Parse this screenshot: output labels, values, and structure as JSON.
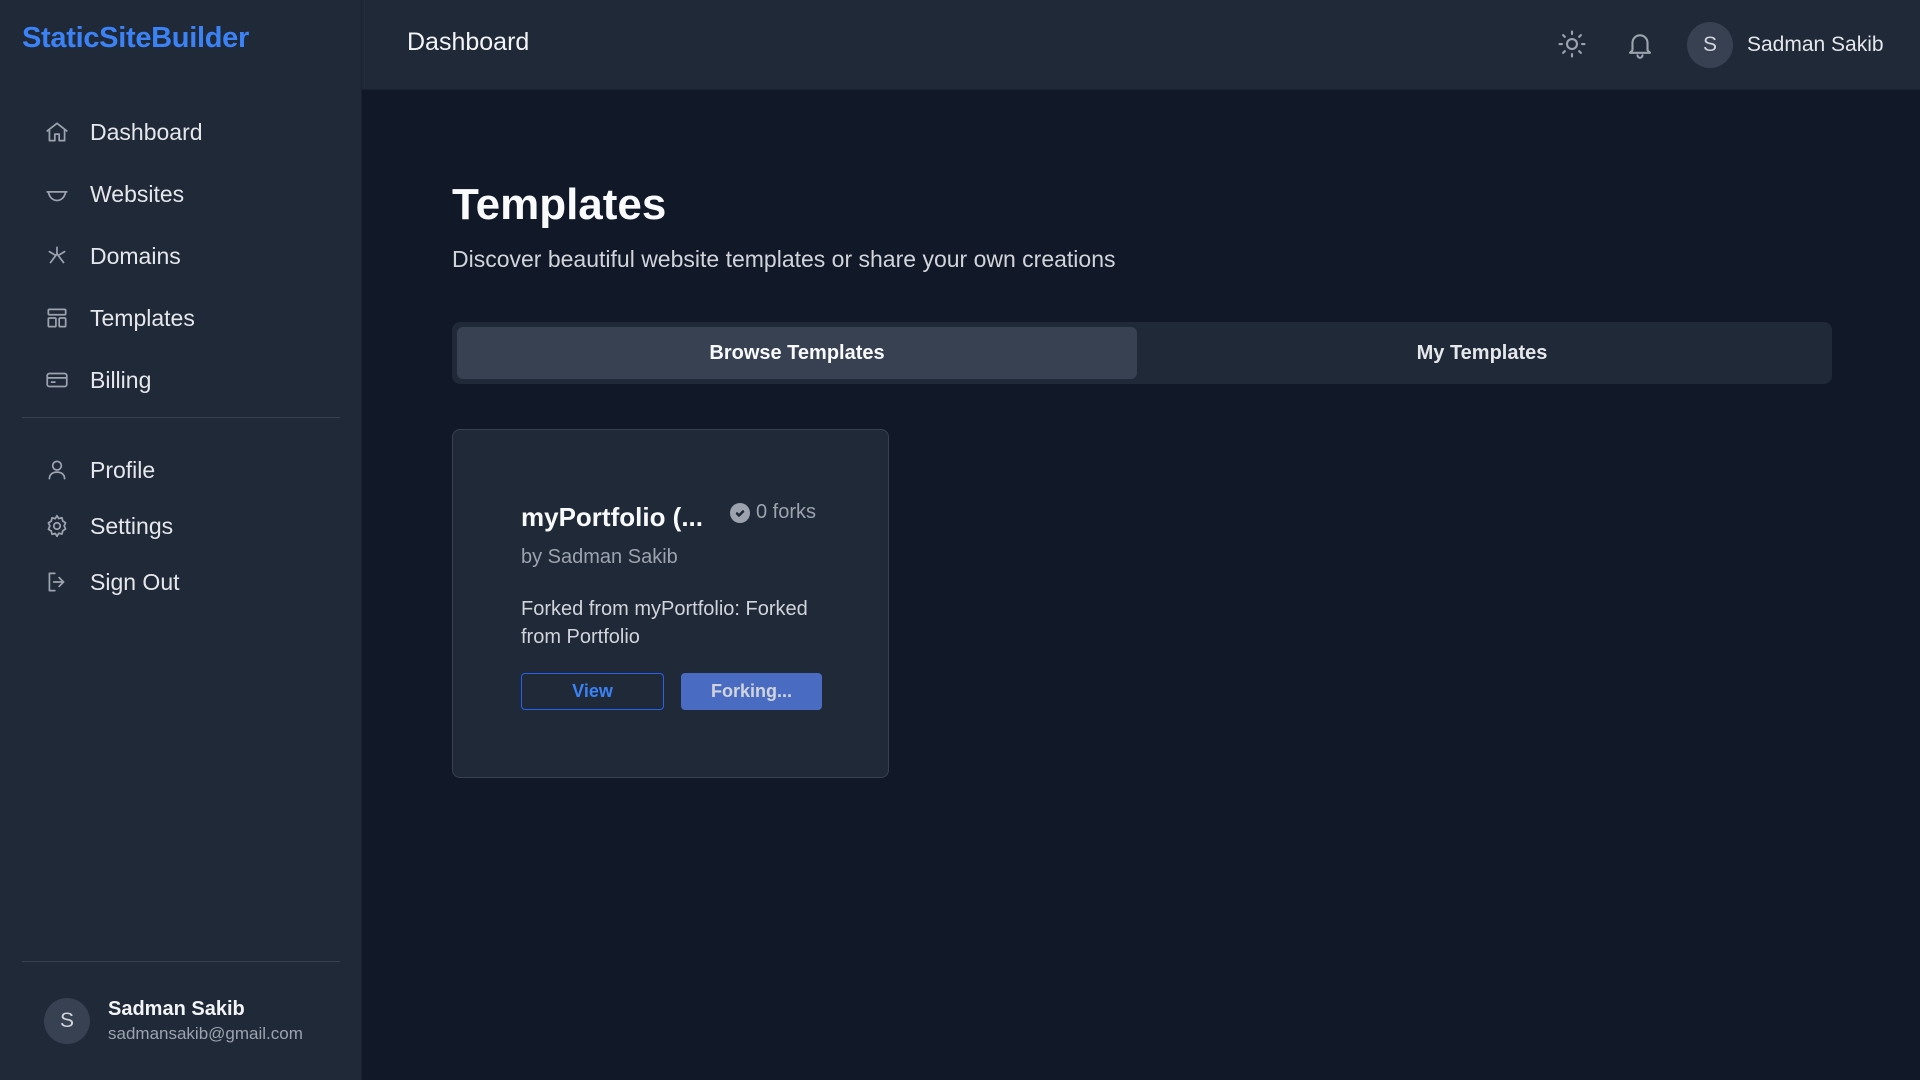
{
  "brand": "StaticSiteBuilder",
  "header": {
    "title": "Dashboard",
    "user_name": "Sadman Sakib",
    "avatar_initial": "S"
  },
  "sidebar": {
    "primary": [
      {
        "label": "Dashboard",
        "icon": "home-icon"
      },
      {
        "label": "Websites",
        "icon": "websites-icon"
      },
      {
        "label": "Domains",
        "icon": "domains-icon"
      },
      {
        "label": "Templates",
        "icon": "templates-icon"
      },
      {
        "label": "Billing",
        "icon": "credit-card-icon"
      }
    ],
    "secondary": [
      {
        "label": "Profile",
        "icon": "user-icon"
      },
      {
        "label": "Settings",
        "icon": "gear-icon"
      },
      {
        "label": "Sign Out",
        "icon": "sign-out-icon"
      }
    ],
    "user": {
      "initial": "S",
      "name": "Sadman Sakib",
      "email": "sadmansakib@gmail.com"
    }
  },
  "main": {
    "title": "Templates",
    "subtitle": "Discover beautiful website templates or share your own creations",
    "tabs": [
      {
        "label": "Browse Templates",
        "active": true
      },
      {
        "label": "My Templates",
        "active": false
      }
    ],
    "cards": [
      {
        "title": "myPortfolio (...",
        "forks": "0 forks",
        "author": "by Sadman Sakib",
        "description": "Forked from myPortfolio: Forked from Portfolio",
        "view_label": "View",
        "fork_label": "Forking..."
      }
    ]
  },
  "colors": {
    "accent": "#3b82f6",
    "background": "#111827",
    "surface": "#1f2937"
  }
}
